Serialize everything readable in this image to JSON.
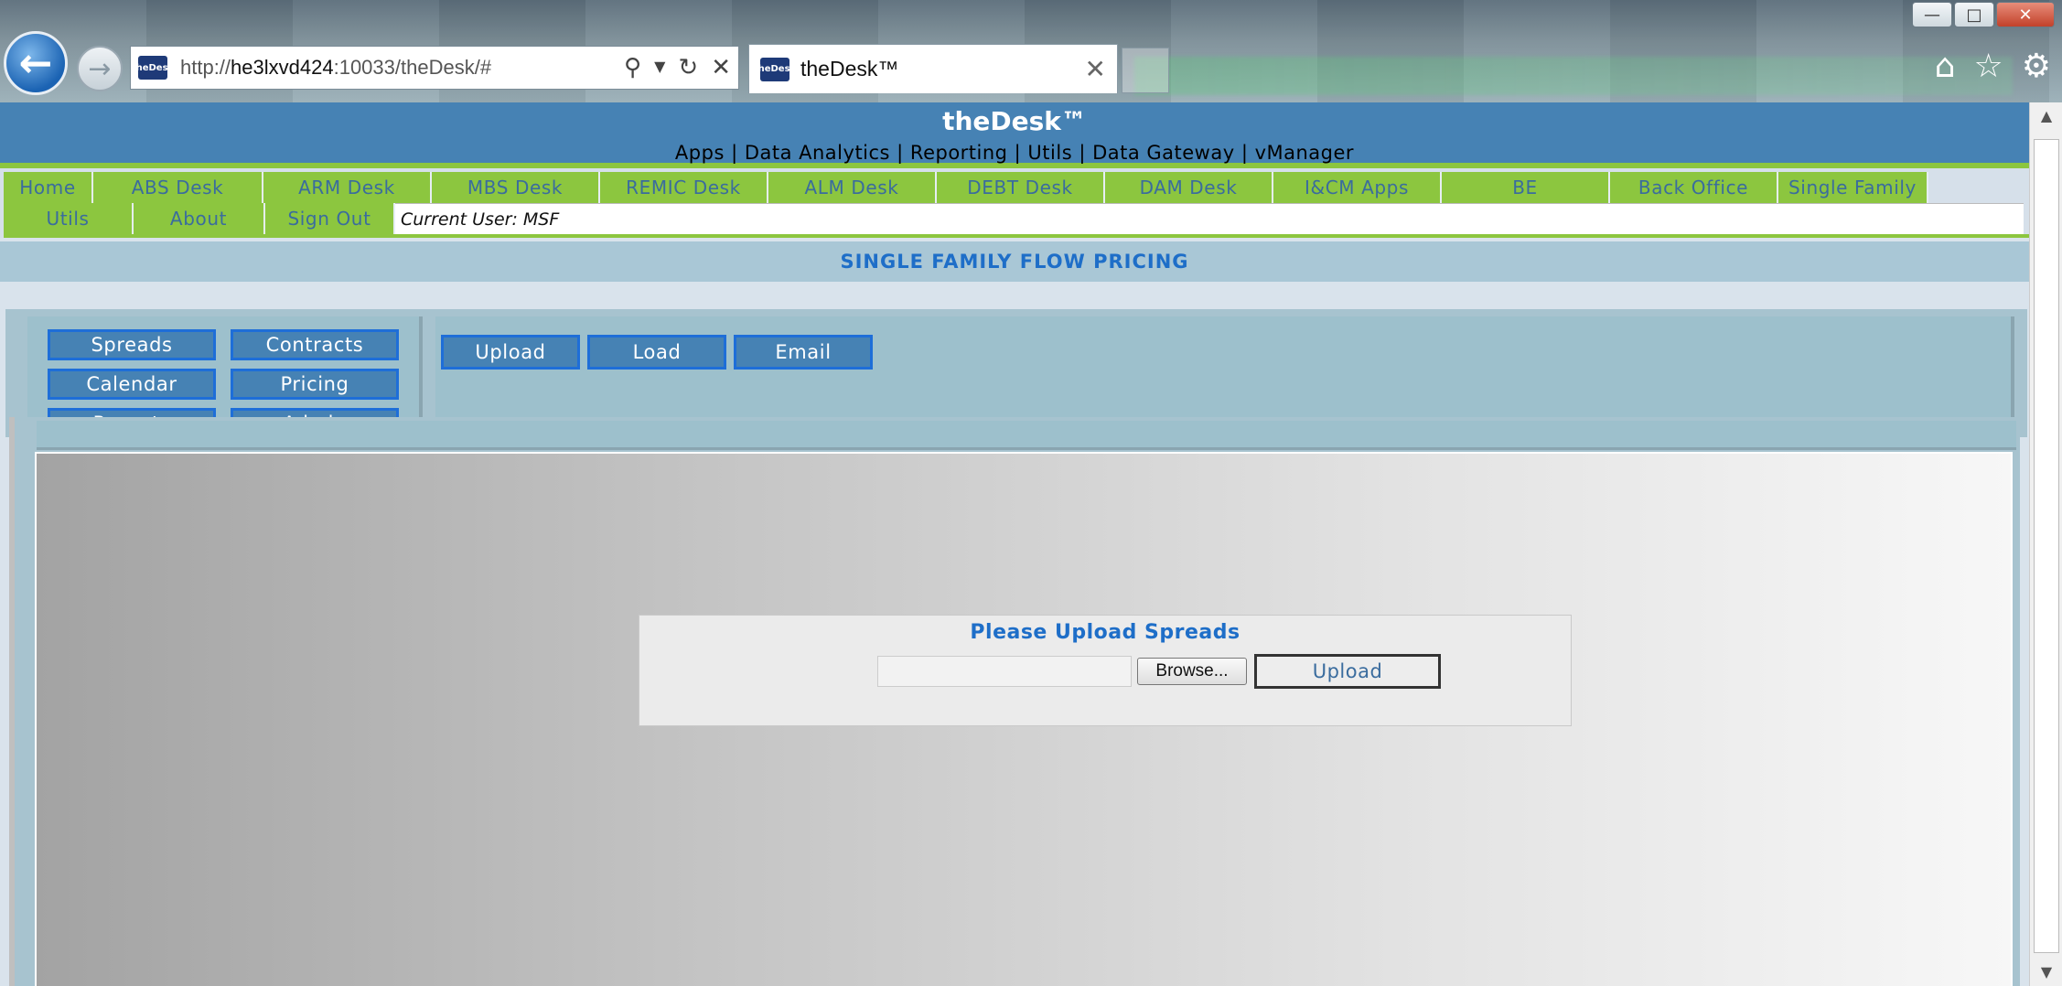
{
  "browser": {
    "url_host": "he3lxvd424",
    "url_rest": ":10033/theDesk/#",
    "url_prefix": "http://",
    "tab_title": "theDesk™",
    "favicon_text": "theDesk"
  },
  "banner": {
    "title": "theDesk™",
    "links": "Apps | Data Analytics | Reporting | Utils | Data Gateway | vManager"
  },
  "menu": {
    "row1": [
      "Home",
      "ABS Desk",
      "ARM Desk",
      "MBS Desk",
      "REMIC Desk",
      "ALM Desk",
      "DEBT Desk",
      "DAM Desk",
      "I&CM Apps",
      "BE",
      "Back Office",
      "Single Family"
    ],
    "row2": [
      "Utils",
      "About",
      "Sign Out"
    ],
    "current_user": "Current User: MSF"
  },
  "subtitle": "SINGLE FAMILY FLOW PRICING",
  "left_buttons": [
    "Spreads",
    "Contracts",
    "Calendar",
    "Pricing",
    "Reports",
    "Admin"
  ],
  "right_buttons": [
    "Upload",
    "Load",
    "Email"
  ],
  "upload_box": {
    "heading": "Please Upload Spreads",
    "browse": "Browse...",
    "upload": "Upload"
  },
  "colors": {
    "banner": "#4682b4",
    "menu_green": "#8cc63f",
    "accent_blue": "#1e6ec8"
  }
}
